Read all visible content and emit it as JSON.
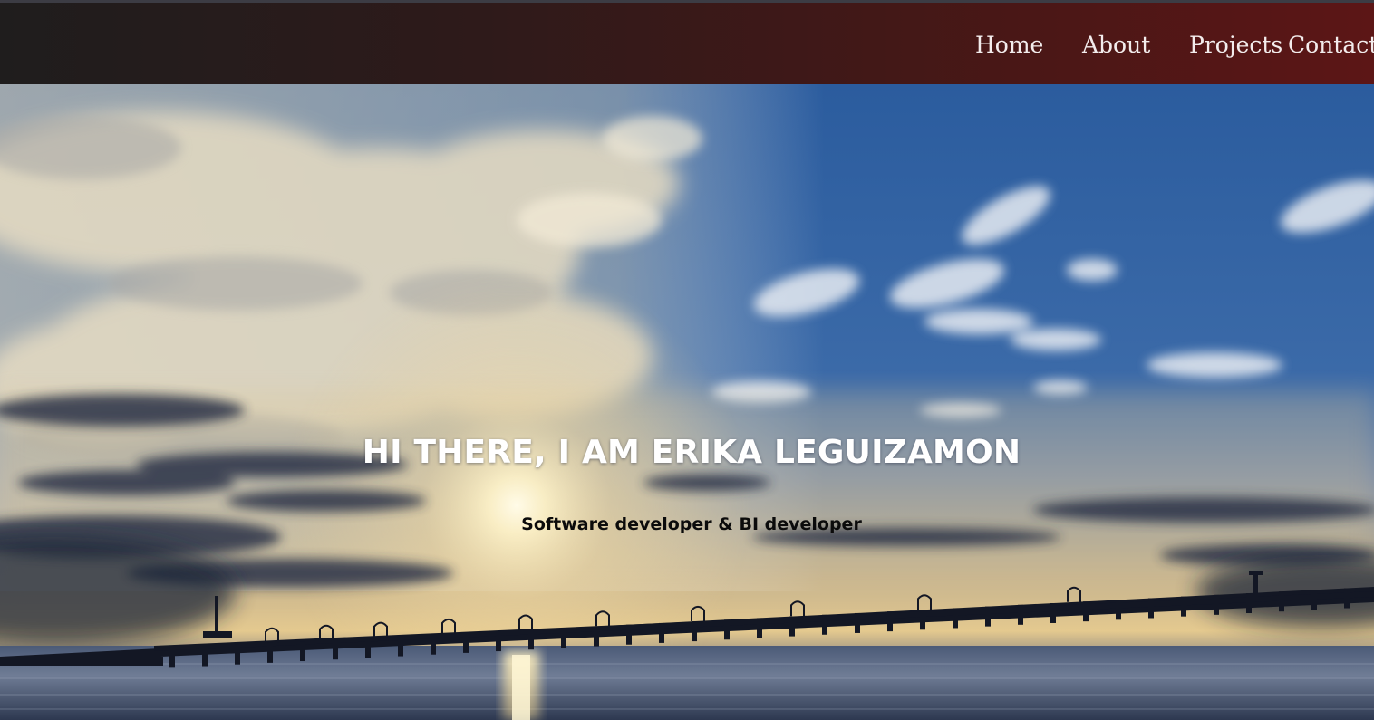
{
  "nav": {
    "links": [
      {
        "label": "Home"
      },
      {
        "label": "About"
      },
      {
        "label": "Projects"
      },
      {
        "label": "Contact"
      }
    ]
  },
  "hero": {
    "title": "HI THERE, I AM ERIKA LEGUIZAMON",
    "subtitle": "Software developer & BI developer"
  },
  "colors": {
    "navbar_gradient_start": "#1f1d1d",
    "navbar_gradient_end": "#5c1616",
    "nav_text": "#f3ecec",
    "hero_title": "#ffffff",
    "hero_subtitle": "#0b0b0b"
  }
}
